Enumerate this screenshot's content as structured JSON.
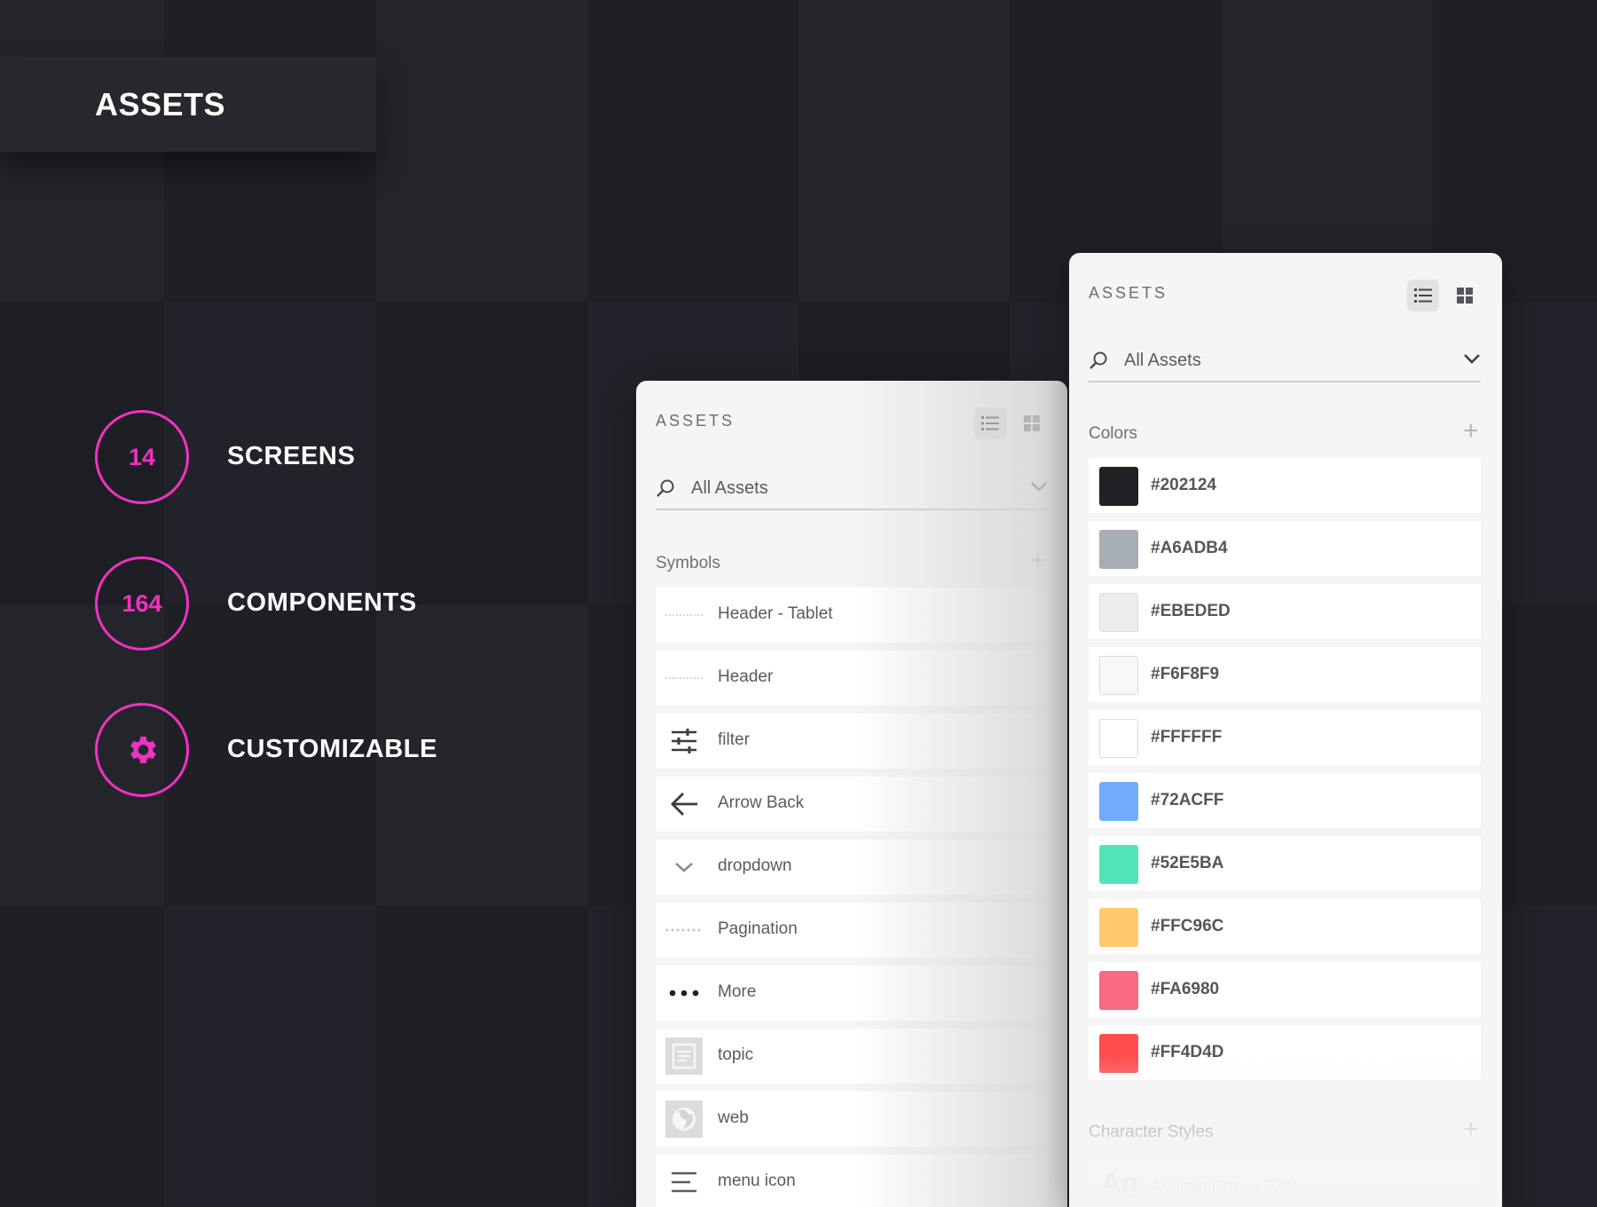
{
  "page_title": "ASSETS",
  "stats": [
    {
      "value": "14",
      "label": "SCREENS"
    },
    {
      "value": "164",
      "label": "COMPONENTS"
    },
    {
      "icon": "gear-icon",
      "label": "CUSTOMIZABLE"
    }
  ],
  "accent_color": "#F032C0",
  "left_panel": {
    "title": "ASSETS",
    "filter": "All Assets",
    "section": "Symbols",
    "symbols": [
      {
        "label": "Header - Tablet",
        "icon": "header-line-thumb"
      },
      {
        "label": "Header",
        "icon": "header-line-thumb"
      },
      {
        "label": "filter",
        "icon": "sliders-icon"
      },
      {
        "label": "Arrow Back",
        "icon": "arrow-back-icon"
      },
      {
        "label": "dropdown",
        "icon": "chevron-down-icon"
      },
      {
        "label": "Pagination",
        "icon": "pagination-dots-thumb"
      },
      {
        "label": "More",
        "icon": "more-dots-icon"
      },
      {
        "label": "topic",
        "icon": "topic-icon"
      },
      {
        "label": "web",
        "icon": "globe-icon"
      },
      {
        "label": "menu icon",
        "icon": "menu-icon"
      }
    ]
  },
  "right_panel": {
    "title": "ASSETS",
    "filter": "All Assets",
    "colors_section": "Colors",
    "colors": [
      "#202124",
      "#A6ADB4",
      "#EBEDED",
      "#F6F8F9",
      "#FFFFFF",
      "#72ACFF",
      "#52E5BA",
      "#FFC96C",
      "#FA6980",
      "#FF4D4D"
    ],
    "char_section": "Character Styles",
    "char_styles": [
      {
        "sample": "Ag",
        "label": "Acumin Pro — 32pt"
      }
    ]
  }
}
